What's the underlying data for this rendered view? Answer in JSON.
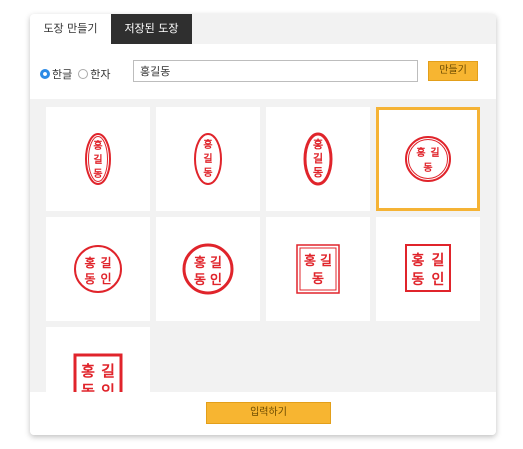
{
  "tabs": [
    {
      "label": "도장 만들기"
    },
    {
      "label": "저장된 도장"
    }
  ],
  "form": {
    "radio_hangul": "한글",
    "radio_hanja": "한자",
    "name_value": "홍길동",
    "make_label": "만들기"
  },
  "stamps": [
    {
      "name": "stamp-oval-vertical-1",
      "text": "홍길동"
    },
    {
      "name": "stamp-oval-vertical-2",
      "text": "홍길동"
    },
    {
      "name": "stamp-oval-vertical-3",
      "text": "홍길동"
    },
    {
      "name": "stamp-circle-1",
      "text": "홍길동"
    },
    {
      "name": "stamp-circle-2",
      "text": "홍길동인"
    },
    {
      "name": "stamp-circle-3",
      "text": "홍길동인"
    },
    {
      "name": "stamp-square-1",
      "text": "홍길동"
    },
    {
      "name": "stamp-square-2",
      "text": "홍길동인"
    },
    {
      "name": "stamp-square-3",
      "text": "홍길동인"
    }
  ],
  "selected_index": 3,
  "submit_label": "입력하기",
  "colors": {
    "accent": "#f7b531",
    "stamp_red": "#e0242b",
    "tab_dark": "#2f2f2f"
  }
}
